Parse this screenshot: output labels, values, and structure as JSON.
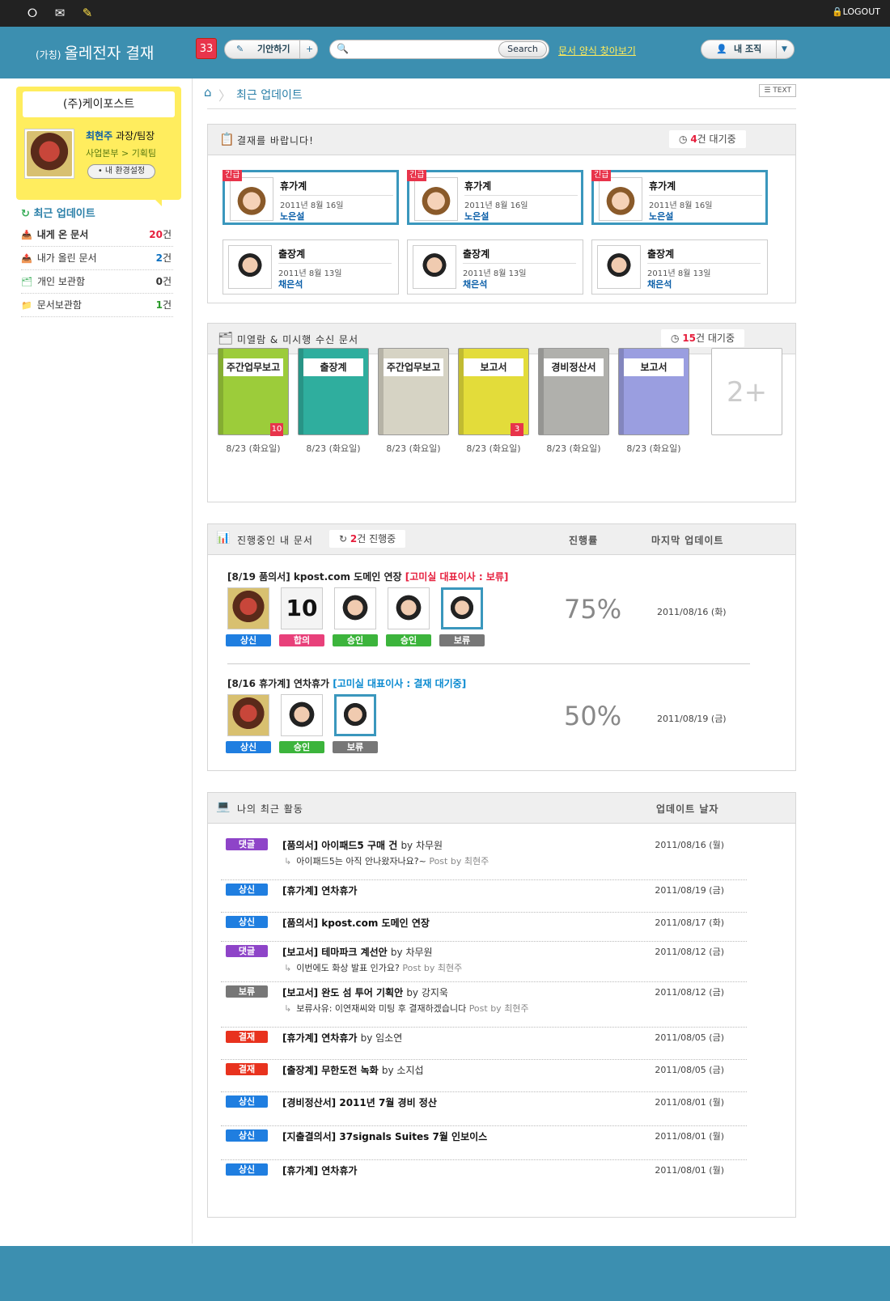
{
  "topbar": {
    "logout": "LOGOUT"
  },
  "header": {
    "brand_prefix": "(가칭)",
    "brand": "올레전자 결재",
    "badge": "33",
    "draft_button": "기안하기",
    "draft_plus": "+",
    "search_button": "Search",
    "search_placeholder": "",
    "form_link": "문서 양식 찾아보기",
    "org_button": "내 조직"
  },
  "sidebar": {
    "company": "(주)케이포스트",
    "name": "최현주",
    "position": "과장/팀장",
    "dept": "사업본부 > 기획팀",
    "settings": "• 내 환경설정",
    "section_title": "최근 업데이트",
    "items": [
      {
        "label": "내게 온 문서",
        "count": "20",
        "unit": "건",
        "color": "#e61e3c"
      },
      {
        "label": "내가 올린 문서",
        "count": "2",
        "unit": "건",
        "color": "#0a6fc0"
      },
      {
        "label": "개인 보관함",
        "count": "0",
        "unit": "건",
        "color": "#333333"
      },
      {
        "label": "문서보관함",
        "count": "1",
        "unit": "건",
        "color": "#2a9a2a"
      }
    ]
  },
  "breadcrumb": {
    "title": "최근 업데이트",
    "text_button": "TEXT"
  },
  "approval_request": {
    "title": "결재를 바랍니다!",
    "wait_count": "4",
    "wait_label": "건 대기중",
    "urgent_tag": "긴급",
    "cards": [
      {
        "doc": "휴가계",
        "date": "2011년 8월 16일",
        "who": "노은설",
        "urgent": true
      },
      {
        "doc": "휴가계",
        "date": "2011년 8월 16일",
        "who": "노은설",
        "urgent": true
      },
      {
        "doc": "휴가계",
        "date": "2011년 8월 16일",
        "who": "노은설",
        "urgent": true
      },
      {
        "doc": "출장계",
        "date": "2011년 8월 13일",
        "who": "채은석",
        "urgent": false
      },
      {
        "doc": "출장계",
        "date": "2011년 8월 13일",
        "who": "채은석",
        "urgent": false
      },
      {
        "doc": "출장계",
        "date": "2011년 8월 13일",
        "who": "채은석",
        "urgent": false
      }
    ]
  },
  "unread": {
    "title": "미열람 & 미시행 수신 문서",
    "wait_count": "15",
    "wait_label": "건 대기중",
    "more": "2+",
    "books": [
      {
        "label": "주간업무보고",
        "date": "8/23 (화요일)",
        "color": "#9ccc3a",
        "badge": "10"
      },
      {
        "label": "출장계",
        "date": "8/23 (화요일)",
        "color": "#2fae9e",
        "badge": ""
      },
      {
        "label": "주간업무보고",
        "date": "8/23 (화요일)",
        "color": "#d6d3c4",
        "badge": ""
      },
      {
        "label": "보고서",
        "date": "8/23 (화요일)",
        "color": "#e3dc3a",
        "badge": "3"
      },
      {
        "label": "경비정산서",
        "date": "8/23 (화요일)",
        "color": "#b0b0ac",
        "badge": ""
      },
      {
        "label": "보고서",
        "date": "8/23 (화요일)",
        "color": "#9a9ee0",
        "badge": ""
      }
    ]
  },
  "in_progress": {
    "title": "진행중인 내 문서",
    "count": "2",
    "count_label": "건 진행중",
    "col_progress": "진행률",
    "col_update": "마지막 업데이트",
    "docs": [
      {
        "title": "[8/19 품의서] kpost.com 도메인 연장 ",
        "status": "[고미실 대표이사 : 보류]",
        "status_color": "#e61e3c",
        "progress": "75%",
        "date": "2011/08/16 (화)",
        "people": [
          {
            "stat": "상신",
            "color": "#1f7ee0",
            "num": ""
          },
          {
            "stat": "합의",
            "color": "#e8407a",
            "num": "10"
          },
          {
            "stat": "승인",
            "color": "#3cb43c",
            "num": ""
          },
          {
            "stat": "승인",
            "color": "#3cb43c",
            "num": ""
          },
          {
            "stat": "보류",
            "color": "#777777",
            "num": ""
          }
        ]
      },
      {
        "title": "[8/16 휴가계] 연차휴가 ",
        "status": "[고미실 대표이사 : 결재 대기중]",
        "status_color": "#0a8ad0",
        "progress": "50%",
        "date": "2011/08/19 (금)",
        "people": [
          {
            "stat": "상신",
            "color": "#1f7ee0",
            "num": ""
          },
          {
            "stat": "승인",
            "color": "#3cb43c",
            "num": ""
          },
          {
            "stat": "보류",
            "color": "#777777",
            "num": ""
          }
        ]
      }
    ]
  },
  "activity": {
    "title": "나의 최근 활동",
    "col_date": "업데이트 날자",
    "rows": [
      {
        "tag": "댓글",
        "color": "#8e44c8",
        "text": "[품의서] 아이패드5 구매 건 ",
        "by": "by 차무원",
        "sub": "아이패드5는 아직 안나왔자나요?~ ",
        "sub_by": "Post by 최현주",
        "date": "2011/08/16 (월)"
      },
      {
        "tag": "상신",
        "color": "#1f7ee0",
        "text": "[휴가계] 연차휴가",
        "by": "",
        "sub": "",
        "sub_by": "",
        "date": "2011/08/19 (금)"
      },
      {
        "tag": "상신",
        "color": "#1f7ee0",
        "text": "[품의서] kpost.com 도메인 연장",
        "by": "",
        "sub": "",
        "sub_by": "",
        "date": "2011/08/17 (화)"
      },
      {
        "tag": "댓글",
        "color": "#8e44c8",
        "text": "[보고서] 테마파크 계선안 ",
        "by": "by 차무원",
        "sub": "이번에도 화상 발표 인가요? ",
        "sub_by": "Post by 최현주",
        "date": "2011/08/12 (금)"
      },
      {
        "tag": "보류",
        "color": "#777777",
        "text": "[보고서] 완도 섬 투어 기획안 ",
        "by": "by 강지욱",
        "sub": "보류사유: 이연재씨와 미팅 후 결재하겠습니다 ",
        "sub_by": "Post by 최현주",
        "date": "2011/08/12 (금)"
      },
      {
        "tag": "결재",
        "color": "#e8321e",
        "text": "[휴가계] 연차휴가 ",
        "by": "by 임소연",
        "sub": "",
        "sub_by": "",
        "date": "2011/08/05 (금)"
      },
      {
        "tag": "결재",
        "color": "#e8321e",
        "text": "[출장계] 무한도전 녹화 ",
        "by": "by 소지섭",
        "sub": "",
        "sub_by": "",
        "date": "2011/08/05 (금)"
      },
      {
        "tag": "상신",
        "color": "#1f7ee0",
        "text": "[경비정산서] 2011년 7월 경비 정산",
        "by": "",
        "sub": "",
        "sub_by": "",
        "date": "2011/08/01 (월)"
      },
      {
        "tag": "상신",
        "color": "#1f7ee0",
        "text": "[지출결의서] 37signals Suites 7월 인보이스",
        "by": "",
        "sub": "",
        "sub_by": "",
        "date": "2011/08/01 (월)"
      },
      {
        "tag": "상신",
        "color": "#1f7ee0",
        "text": "[휴가계] 연차휴가",
        "by": "",
        "sub": "",
        "sub_by": "",
        "date": "2011/08/01 (월)"
      }
    ]
  }
}
